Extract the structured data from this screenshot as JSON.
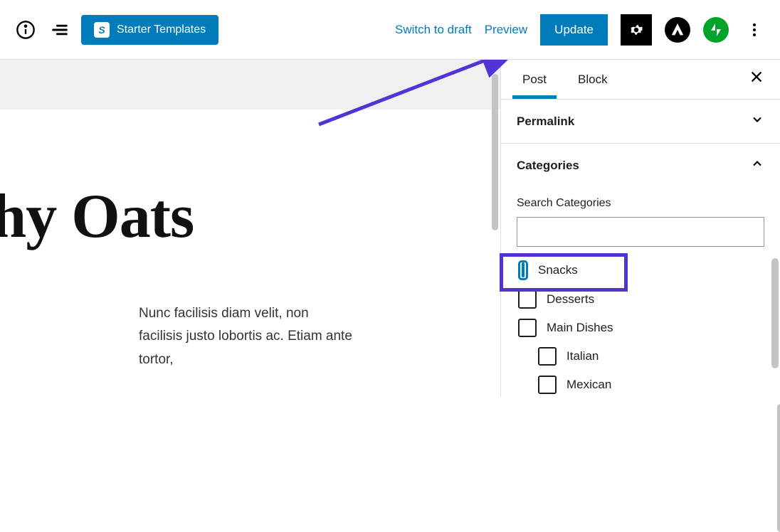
{
  "toolbar": {
    "starter_label": "Starter Templates",
    "starter_icon": "S",
    "switch_draft": "Switch to draft",
    "preview": "Preview",
    "update": "Update"
  },
  "editor": {
    "title": "thy Oats",
    "body": "Nunc facilisis diam velit, non facilisis justo lobortis ac. Etiam ante tortor,"
  },
  "sidebar": {
    "tabs": {
      "post": "Post",
      "block": "Block"
    },
    "permalink": "Permalink",
    "categories": {
      "title": "Categories",
      "search_label": "Search Categories",
      "items": [
        {
          "label": "Snacks",
          "indent": false
        },
        {
          "label": "Desserts",
          "indent": false
        },
        {
          "label": "Main Dishes",
          "indent": false
        },
        {
          "label": "Italian",
          "indent": true
        },
        {
          "label": "Mexican",
          "indent": true
        }
      ]
    }
  }
}
